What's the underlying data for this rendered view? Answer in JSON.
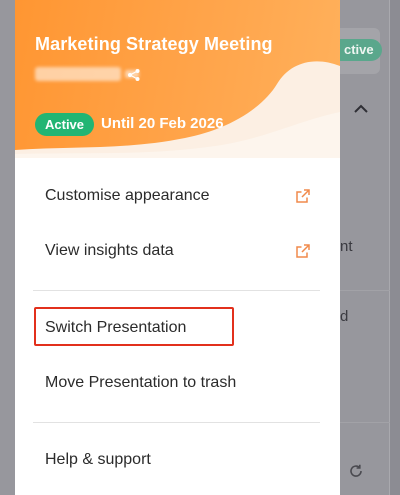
{
  "header": {
    "title": "Marketing Strategy Meeting",
    "status_badge": "Active",
    "until": "Until 20 Feb 2026",
    "share_icon": "share-icon"
  },
  "menu": {
    "items": [
      {
        "label": "Customise appearance",
        "icon": "external-link-icon"
      },
      {
        "label": "View insights data",
        "icon": "external-link-icon"
      },
      {
        "label": "Switch Presentation"
      },
      {
        "label": "Move Presentation to trash"
      },
      {
        "label": "Help & support"
      }
    ]
  },
  "background": {
    "badge_fragment": "ctive",
    "text_fragment_1": "nt",
    "text_fragment_2": "d"
  },
  "colors": {
    "header_orange": "#ff9632",
    "active_green": "#22b573",
    "external_icon": "#f08a4b",
    "highlight_red": "#e2301c"
  }
}
